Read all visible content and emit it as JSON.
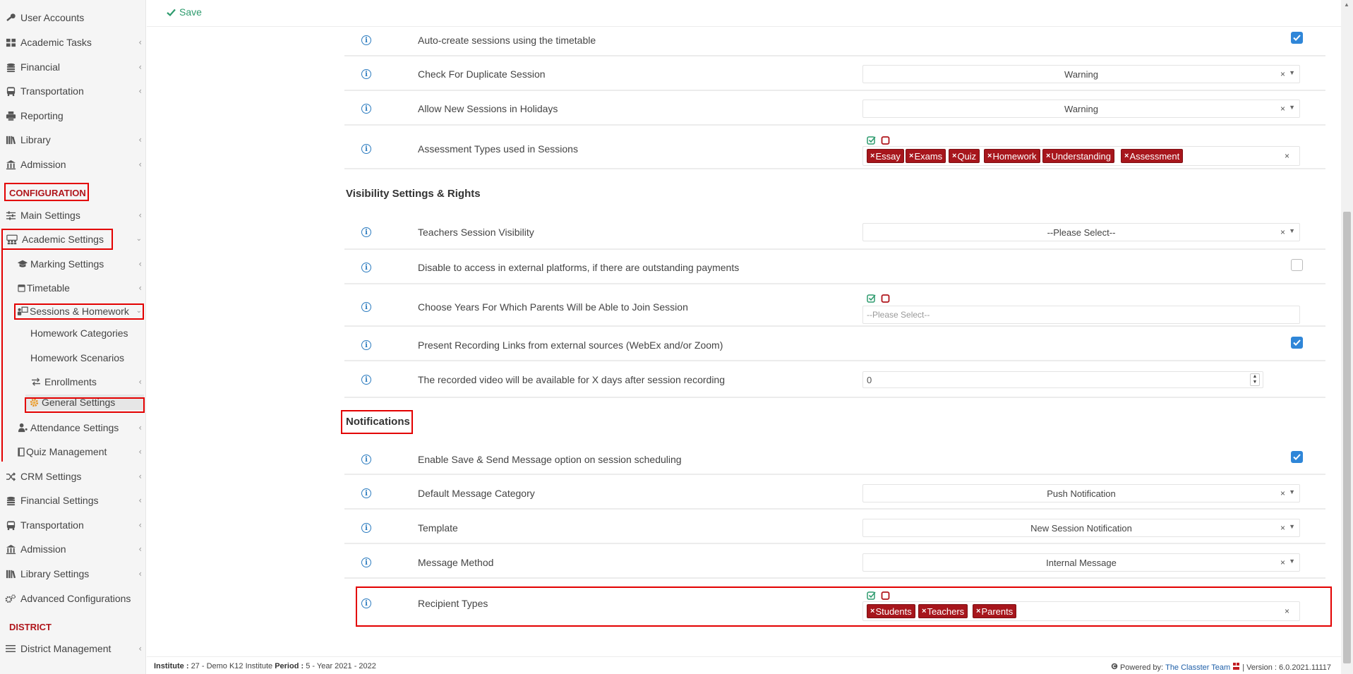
{
  "sidebar": {
    "items": [
      {
        "label": "User Accounts",
        "icon": "key-icon"
      },
      {
        "label": "Academic Tasks",
        "icon": "grid-icon"
      },
      {
        "label": "Financial",
        "icon": "coins-icon"
      },
      {
        "label": "Transportation",
        "icon": "bus-icon"
      },
      {
        "label": "Reporting",
        "icon": "printer-icon"
      },
      {
        "label": "Library",
        "icon": "books-icon"
      },
      {
        "label": "Admission",
        "icon": "building-icon"
      }
    ],
    "configuration_heading": "CONFIGURATION",
    "config_items": [
      {
        "label": "Main Settings",
        "icon": "sliders-icon"
      },
      {
        "label": "Academic Settings",
        "icon": "users-group-icon"
      },
      {
        "label": "Marking Settings",
        "icon": "graduation-cap-icon"
      },
      {
        "label": "Timetable",
        "icon": "calendar-icon"
      },
      {
        "label": "Sessions & Homework",
        "icon": "teacher-board-icon"
      },
      {
        "label": "Homework Categories",
        "icon": ""
      },
      {
        "label": "Homework Scenarios",
        "icon": ""
      },
      {
        "label": "Enrollments",
        "icon": "exchange-icon"
      },
      {
        "label": "General Settings",
        "icon": "gear-icon"
      },
      {
        "label": "Attendance Settings",
        "icon": "user-check-icon"
      },
      {
        "label": "Quiz Management",
        "icon": "book-icon"
      },
      {
        "label": "CRM Settings",
        "icon": "shuffle-icon"
      },
      {
        "label": "Financial Settings",
        "icon": "coins-icon"
      },
      {
        "label": "Transportation",
        "icon": "bus-icon"
      },
      {
        "label": "Admission",
        "icon": "building-icon"
      },
      {
        "label": "Library Settings",
        "icon": "books-icon"
      },
      {
        "label": "Advanced Configurations",
        "icon": "gears-icon"
      }
    ],
    "district_heading": "DISTRICT",
    "district_items": [
      {
        "label": "District Management",
        "icon": "list-icon"
      }
    ]
  },
  "toolbar": {
    "save_label": "Save"
  },
  "settings": {
    "auto_create": {
      "label": "Auto-create sessions using the timetable",
      "checked": true
    },
    "check_duplicate": {
      "label": "Check For Duplicate Session",
      "value": "Warning"
    },
    "allow_holidays": {
      "label": "Allow New Sessions in Holidays",
      "value": "Warning"
    },
    "assessment_types": {
      "label": "Assessment Types used in Sessions",
      "tags": [
        "Essay",
        "Exams",
        "Quiz",
        "Homework",
        "Understanding",
        "Assessment"
      ]
    },
    "visibility_heading": "Visibility Settings & Rights",
    "teachers_visibility": {
      "label": "Teachers Session Visibility",
      "value": "--Please Select--"
    },
    "disable_external": {
      "label": "Disable to access in external platforms, if there are outstanding payments",
      "checked": false
    },
    "parent_years": {
      "label": "Choose Years For Which Parents Will be Able to Join Session",
      "placeholder": "--Please Select--"
    },
    "recording_links": {
      "label": "Present Recording Links from external sources (WebEx and/or Zoom)",
      "checked": true
    },
    "recorded_days": {
      "label": "The recorded video will be available for X days after session recording",
      "value": "0"
    },
    "notifications_heading": "Notifications",
    "save_send": {
      "label": "Enable Save & Send Message option on session scheduling",
      "checked": true
    },
    "message_category": {
      "label": "Default Message Category",
      "value": "Push Notification"
    },
    "template": {
      "label": "Template",
      "value": "New Session Notification"
    },
    "message_method": {
      "label": "Message Method",
      "value": "Internal Message"
    },
    "recipient_types": {
      "label": "Recipient Types",
      "tags": [
        "Students",
        "Teachers",
        "Parents"
      ]
    }
  },
  "footer": {
    "institute_label": "Institute :",
    "institute_value": "27 - Demo K12 Institute",
    "period_label": "Period :",
    "period_value": "5 - Year 2021 - 2022",
    "powered_by": "Powered by:",
    "powered_link": "The Classter Team",
    "version": "| Version : 6.0.2021.11117"
  },
  "colors": {
    "accent_red": "#a7161c",
    "checkbox_blue": "#2f86d8",
    "save_green": "#2e9b6e",
    "highlight_red": "#e30000"
  }
}
